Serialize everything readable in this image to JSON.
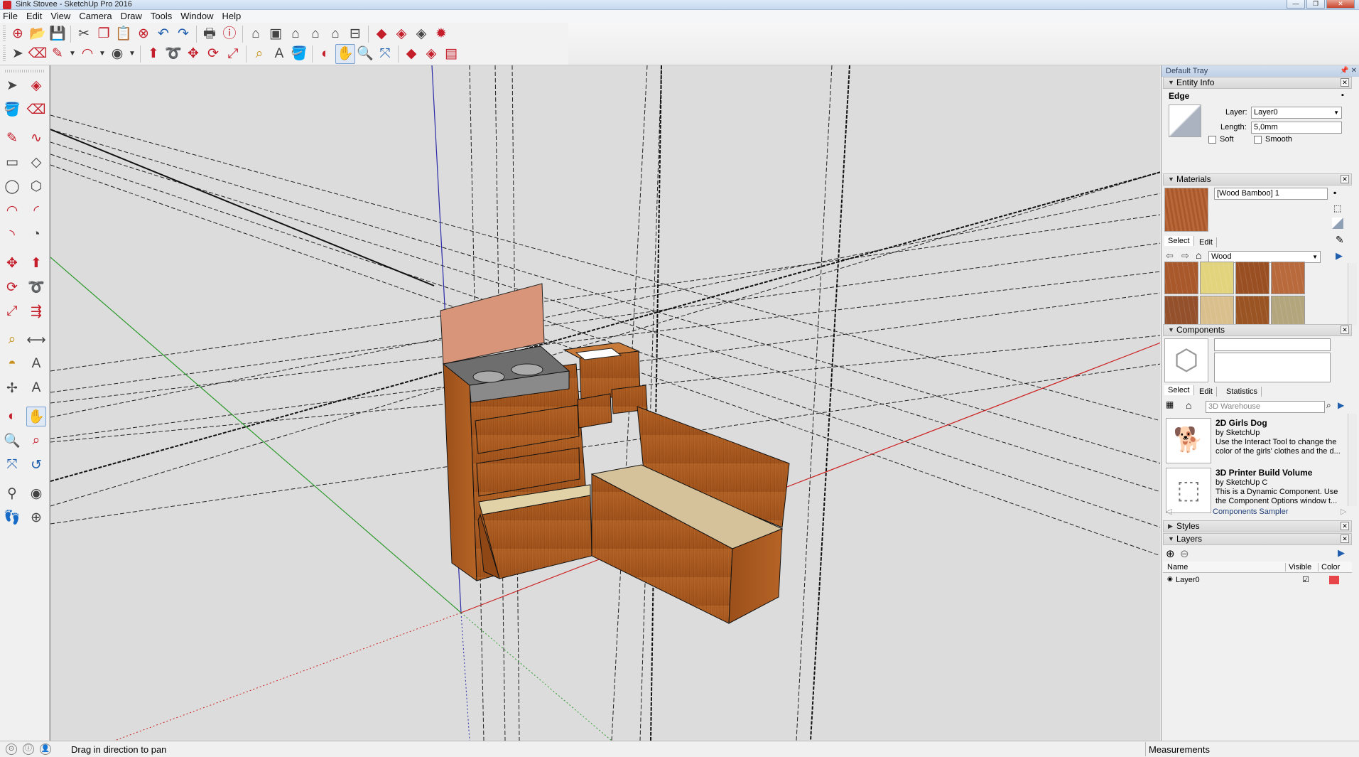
{
  "window": {
    "title": "Sink Stovee - SketchUp Pro 2016",
    "buttons": {
      "minimize": "—",
      "maximize": "❐",
      "close": "✕"
    }
  },
  "menu": [
    "File",
    "Edit",
    "View",
    "Camera",
    "Draw",
    "Tools",
    "Window",
    "Help"
  ],
  "toolbar1": [
    {
      "name": "new-model-icon",
      "glyph": "⊕",
      "color": "red"
    },
    {
      "name": "open-icon",
      "glyph": "📂",
      "color": "gold"
    },
    {
      "name": "save-icon",
      "glyph": "💾",
      "color": "blue"
    },
    {
      "sep": true
    },
    {
      "name": "cut-icon",
      "glyph": "✂",
      "color": "gray"
    },
    {
      "name": "copy-icon",
      "glyph": "❐",
      "color": "red"
    },
    {
      "name": "paste-icon",
      "glyph": "📋",
      "color": "gray"
    },
    {
      "name": "erase-icon",
      "glyph": "⊗",
      "color": "red"
    },
    {
      "name": "undo-icon",
      "glyph": "↶",
      "color": "blue"
    },
    {
      "name": "redo-icon",
      "glyph": "↷",
      "color": "blue"
    },
    {
      "sep": true
    },
    {
      "name": "print-icon",
      "glyph": "🖶",
      "color": "gray"
    },
    {
      "name": "model-info-icon",
      "glyph": "ⓘ",
      "color": "red"
    },
    {
      "sep": true
    },
    {
      "name": "iso-view-icon",
      "glyph": "⌂",
      "color": "gray"
    },
    {
      "name": "top-view-icon",
      "glyph": "▣",
      "color": "gray"
    },
    {
      "name": "front-view-icon",
      "glyph": "⌂",
      "color": "gray"
    },
    {
      "name": "right-view-icon",
      "glyph": "⌂",
      "color": "gray"
    },
    {
      "name": "back-view-icon",
      "glyph": "⌂",
      "color": "gray"
    },
    {
      "name": "left-view-icon",
      "glyph": "⊟",
      "color": "gray"
    },
    {
      "sep": true
    },
    {
      "name": "warehouse-icon",
      "glyph": "◆",
      "color": "red"
    },
    {
      "name": "share-model-icon",
      "glyph": "◈",
      "color": "red"
    },
    {
      "name": "share-component-icon",
      "glyph": "◈",
      "color": "gray"
    },
    {
      "name": "extension-warehouse-icon",
      "glyph": "✹",
      "color": "red"
    }
  ],
  "toolbar2": [
    {
      "name": "select-icon",
      "glyph": "➤",
      "color": "gray"
    },
    {
      "name": "eraser-icon",
      "glyph": "⌫",
      "color": "red"
    },
    {
      "name": "line-icon",
      "glyph": "✎",
      "color": "red"
    },
    {
      "dd": true
    },
    {
      "name": "arc-icon",
      "glyph": "◠",
      "color": "red"
    },
    {
      "dd": true
    },
    {
      "name": "shape-icon",
      "glyph": "◉",
      "color": "gray"
    },
    {
      "dd": true
    },
    {
      "sep": true
    },
    {
      "name": "push-pull-icon",
      "glyph": "⬆",
      "color": "red"
    },
    {
      "name": "follow-me-icon",
      "glyph": "➰",
      "color": "red"
    },
    {
      "name": "move-icon",
      "glyph": "✥",
      "color": "red"
    },
    {
      "name": "rotate-icon",
      "glyph": "⟳",
      "color": "red"
    },
    {
      "name": "scale-icon",
      "glyph": "⤢",
      "color": "red"
    },
    {
      "sep": true
    },
    {
      "name": "tape-measure-icon",
      "glyph": "⌕",
      "color": "gold"
    },
    {
      "name": "text-icon",
      "glyph": "A",
      "color": "gray"
    },
    {
      "name": "paint-bucket-icon",
      "glyph": "🪣",
      "color": "gold"
    },
    {
      "sep": true
    },
    {
      "name": "orbit-icon",
      "glyph": "◐",
      "color": "red"
    },
    {
      "name": "pan-icon",
      "glyph": "✋",
      "color": "gold",
      "active": true
    },
    {
      "name": "zoom-icon",
      "glyph": "🔍",
      "color": "blue"
    },
    {
      "name": "zoom-extents-icon",
      "glyph": "⤧",
      "color": "blue"
    },
    {
      "sep": true
    },
    {
      "name": "get-models-icon",
      "glyph": "◆",
      "color": "red"
    },
    {
      "name": "share-model-2-icon",
      "glyph": "◈",
      "color": "red"
    },
    {
      "name": "extension-manager-icon",
      "glyph": "▤",
      "color": "red"
    }
  ],
  "lefttools": [
    [
      {
        "name": "select-tool-icon",
        "glyph": "➤",
        "color": "gray"
      },
      {
        "name": "component-tool-icon",
        "glyph": "◈",
        "color": "red"
      }
    ],
    [
      {
        "name": "paint-tool-icon",
        "glyph": "🪣",
        "color": "gold"
      },
      {
        "name": "eraser-tool-icon",
        "glyph": "⌫",
        "color": "red"
      }
    ],
    [
      {
        "name": "pencil-tool-icon",
        "glyph": "✎",
        "color": "red",
        "gap": true
      },
      {
        "name": "freehand-tool-icon",
        "glyph": "∿",
        "color": "red"
      }
    ],
    [
      {
        "name": "rectangle-tool-icon",
        "glyph": "▭",
        "color": "gray"
      },
      {
        "name": "rotated-rect-tool-icon",
        "glyph": "◇",
        "color": "gray"
      }
    ],
    [
      {
        "name": "circle-tool-icon",
        "glyph": "◯",
        "color": "gray"
      },
      {
        "name": "polygon-tool-icon",
        "glyph": "⬡",
        "color": "gray"
      }
    ],
    [
      {
        "name": "arc-tool-icon",
        "glyph": "◠",
        "color": "red"
      },
      {
        "name": "two-point-arc-icon",
        "glyph": "◜",
        "color": "red"
      }
    ],
    [
      {
        "name": "three-point-arc-icon",
        "glyph": "◝",
        "color": "red"
      },
      {
        "name": "pie-tool-icon",
        "glyph": "◔",
        "color": "gray"
      }
    ],
    [
      {
        "name": "move-tool-icon",
        "glyph": "✥",
        "color": "red",
        "gap": true
      },
      {
        "name": "push-pull-tool-icon",
        "glyph": "⬆",
        "color": "red"
      }
    ],
    [
      {
        "name": "rotate-tool-icon",
        "glyph": "⟳",
        "color": "red"
      },
      {
        "name": "follow-me-tool-icon",
        "glyph": "➰",
        "color": "red"
      }
    ],
    [
      {
        "name": "scale-tool-icon",
        "glyph": "⤢",
        "color": "red"
      },
      {
        "name": "offset-tool-icon",
        "glyph": "⇶",
        "color": "red"
      }
    ],
    [
      {
        "name": "tape-tool-icon",
        "glyph": "⌕",
        "color": "gold",
        "gap": true
      },
      {
        "name": "dimension-tool-icon",
        "glyph": "⟷",
        "color": "gray"
      }
    ],
    [
      {
        "name": "protractor-tool-icon",
        "glyph": "◓",
        "color": "gold"
      },
      {
        "name": "text-tool-icon",
        "glyph": "A",
        "color": "gray"
      }
    ],
    [
      {
        "name": "axes-tool-icon",
        "glyph": "✢",
        "color": "gray"
      },
      {
        "name": "3d-text-tool-icon",
        "glyph": "A",
        "color": "gray"
      }
    ],
    [
      {
        "name": "orbit-tool-icon",
        "glyph": "◐",
        "color": "red",
        "gap": true
      },
      {
        "name": "pan-tool-icon",
        "glyph": "✋",
        "color": "gold",
        "active": true
      }
    ],
    [
      {
        "name": "zoom-tool-icon",
        "glyph": "🔍",
        "color": "blue"
      },
      {
        "name": "zoom-window-icon",
        "glyph": "⌕",
        "color": "red"
      }
    ],
    [
      {
        "name": "zoom-extents-tool-icon",
        "glyph": "⤧",
        "color": "blue"
      },
      {
        "name": "previous-view-icon",
        "glyph": "↺",
        "color": "blue"
      }
    ],
    [
      {
        "name": "position-camera-icon",
        "glyph": "⚲",
        "color": "gray",
        "gap": true
      },
      {
        "name": "look-around-icon",
        "glyph": "◉",
        "color": "gray"
      }
    ],
    [
      {
        "name": "walk-tool-icon",
        "glyph": "👣",
        "color": "gray"
      },
      {
        "name": "section-plane-icon",
        "glyph": "⊕",
        "color": "gray"
      }
    ]
  ],
  "tray": {
    "title": "Default Tray",
    "entity_info": {
      "header": "Entity Info",
      "type": "Edge",
      "layer_label": "Layer:",
      "layer_value": "Layer0",
      "length_label": "Length:",
      "length_value": "5,0mm",
      "soft_label": "Soft",
      "smooth_label": "Smooth"
    },
    "materials": {
      "header": "Materials",
      "name": "[Wood Bamboo] 1",
      "tabs": [
        "Select",
        "Edit"
      ],
      "library": "Wood",
      "swatch_colors": [
        "#a8582a",
        "#e2d47c",
        "#9a4f22",
        "#b86a3c",
        "#93502a",
        "#d9bf8c",
        "#9a5424",
        "#b3a57c"
      ]
    },
    "components": {
      "header": "Components",
      "tabs": [
        "Select",
        "Edit",
        "Statistics"
      ],
      "search_placeholder": "3D Warehouse",
      "items": [
        {
          "name": "2D Girls Dog",
          "by": "by SketchUp",
          "desc": "Use the Interact Tool to change the color of the girls' clothes and the d..."
        },
        {
          "name": "3D Printer Build Volume",
          "by": "by SketchUp C",
          "desc": "This is a Dynamic Component. Use the Component Options window t..."
        }
      ],
      "sampler": "Components Sampler"
    },
    "styles": {
      "header": "Styles"
    },
    "layers": {
      "header": "Layers",
      "col_name": "Name",
      "col_visible": "Visible",
      "col_color": "Color",
      "rows": [
        {
          "name": "Layer0",
          "visible": "☑",
          "color": "#e8454a"
        }
      ]
    }
  },
  "status": {
    "message": "Drag in direction to pan",
    "measurements_label": "Measurements"
  }
}
